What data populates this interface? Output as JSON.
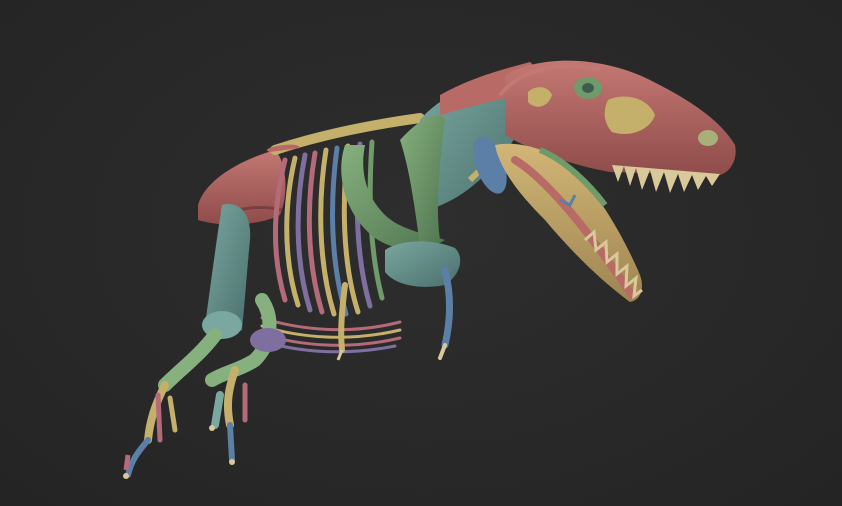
{
  "scene": {
    "background_color": "#2a2a2a",
    "subject": "t-rex-skeleton-render",
    "palette": {
      "skull": "#b86a66",
      "skull_shadow": "#8f4c4a",
      "jaw": "#c8a96a",
      "teeth": "#d8c89a",
      "bone_green": "#6f9a6a",
      "bone_teal": "#5f8a86",
      "bone_yellow": "#c4b06a",
      "bone_purple": "#7f6fa0",
      "bone_blue": "#5b7fa6",
      "bone_rose": "#b46a78",
      "bone_dark": "#3f5a50"
    }
  }
}
